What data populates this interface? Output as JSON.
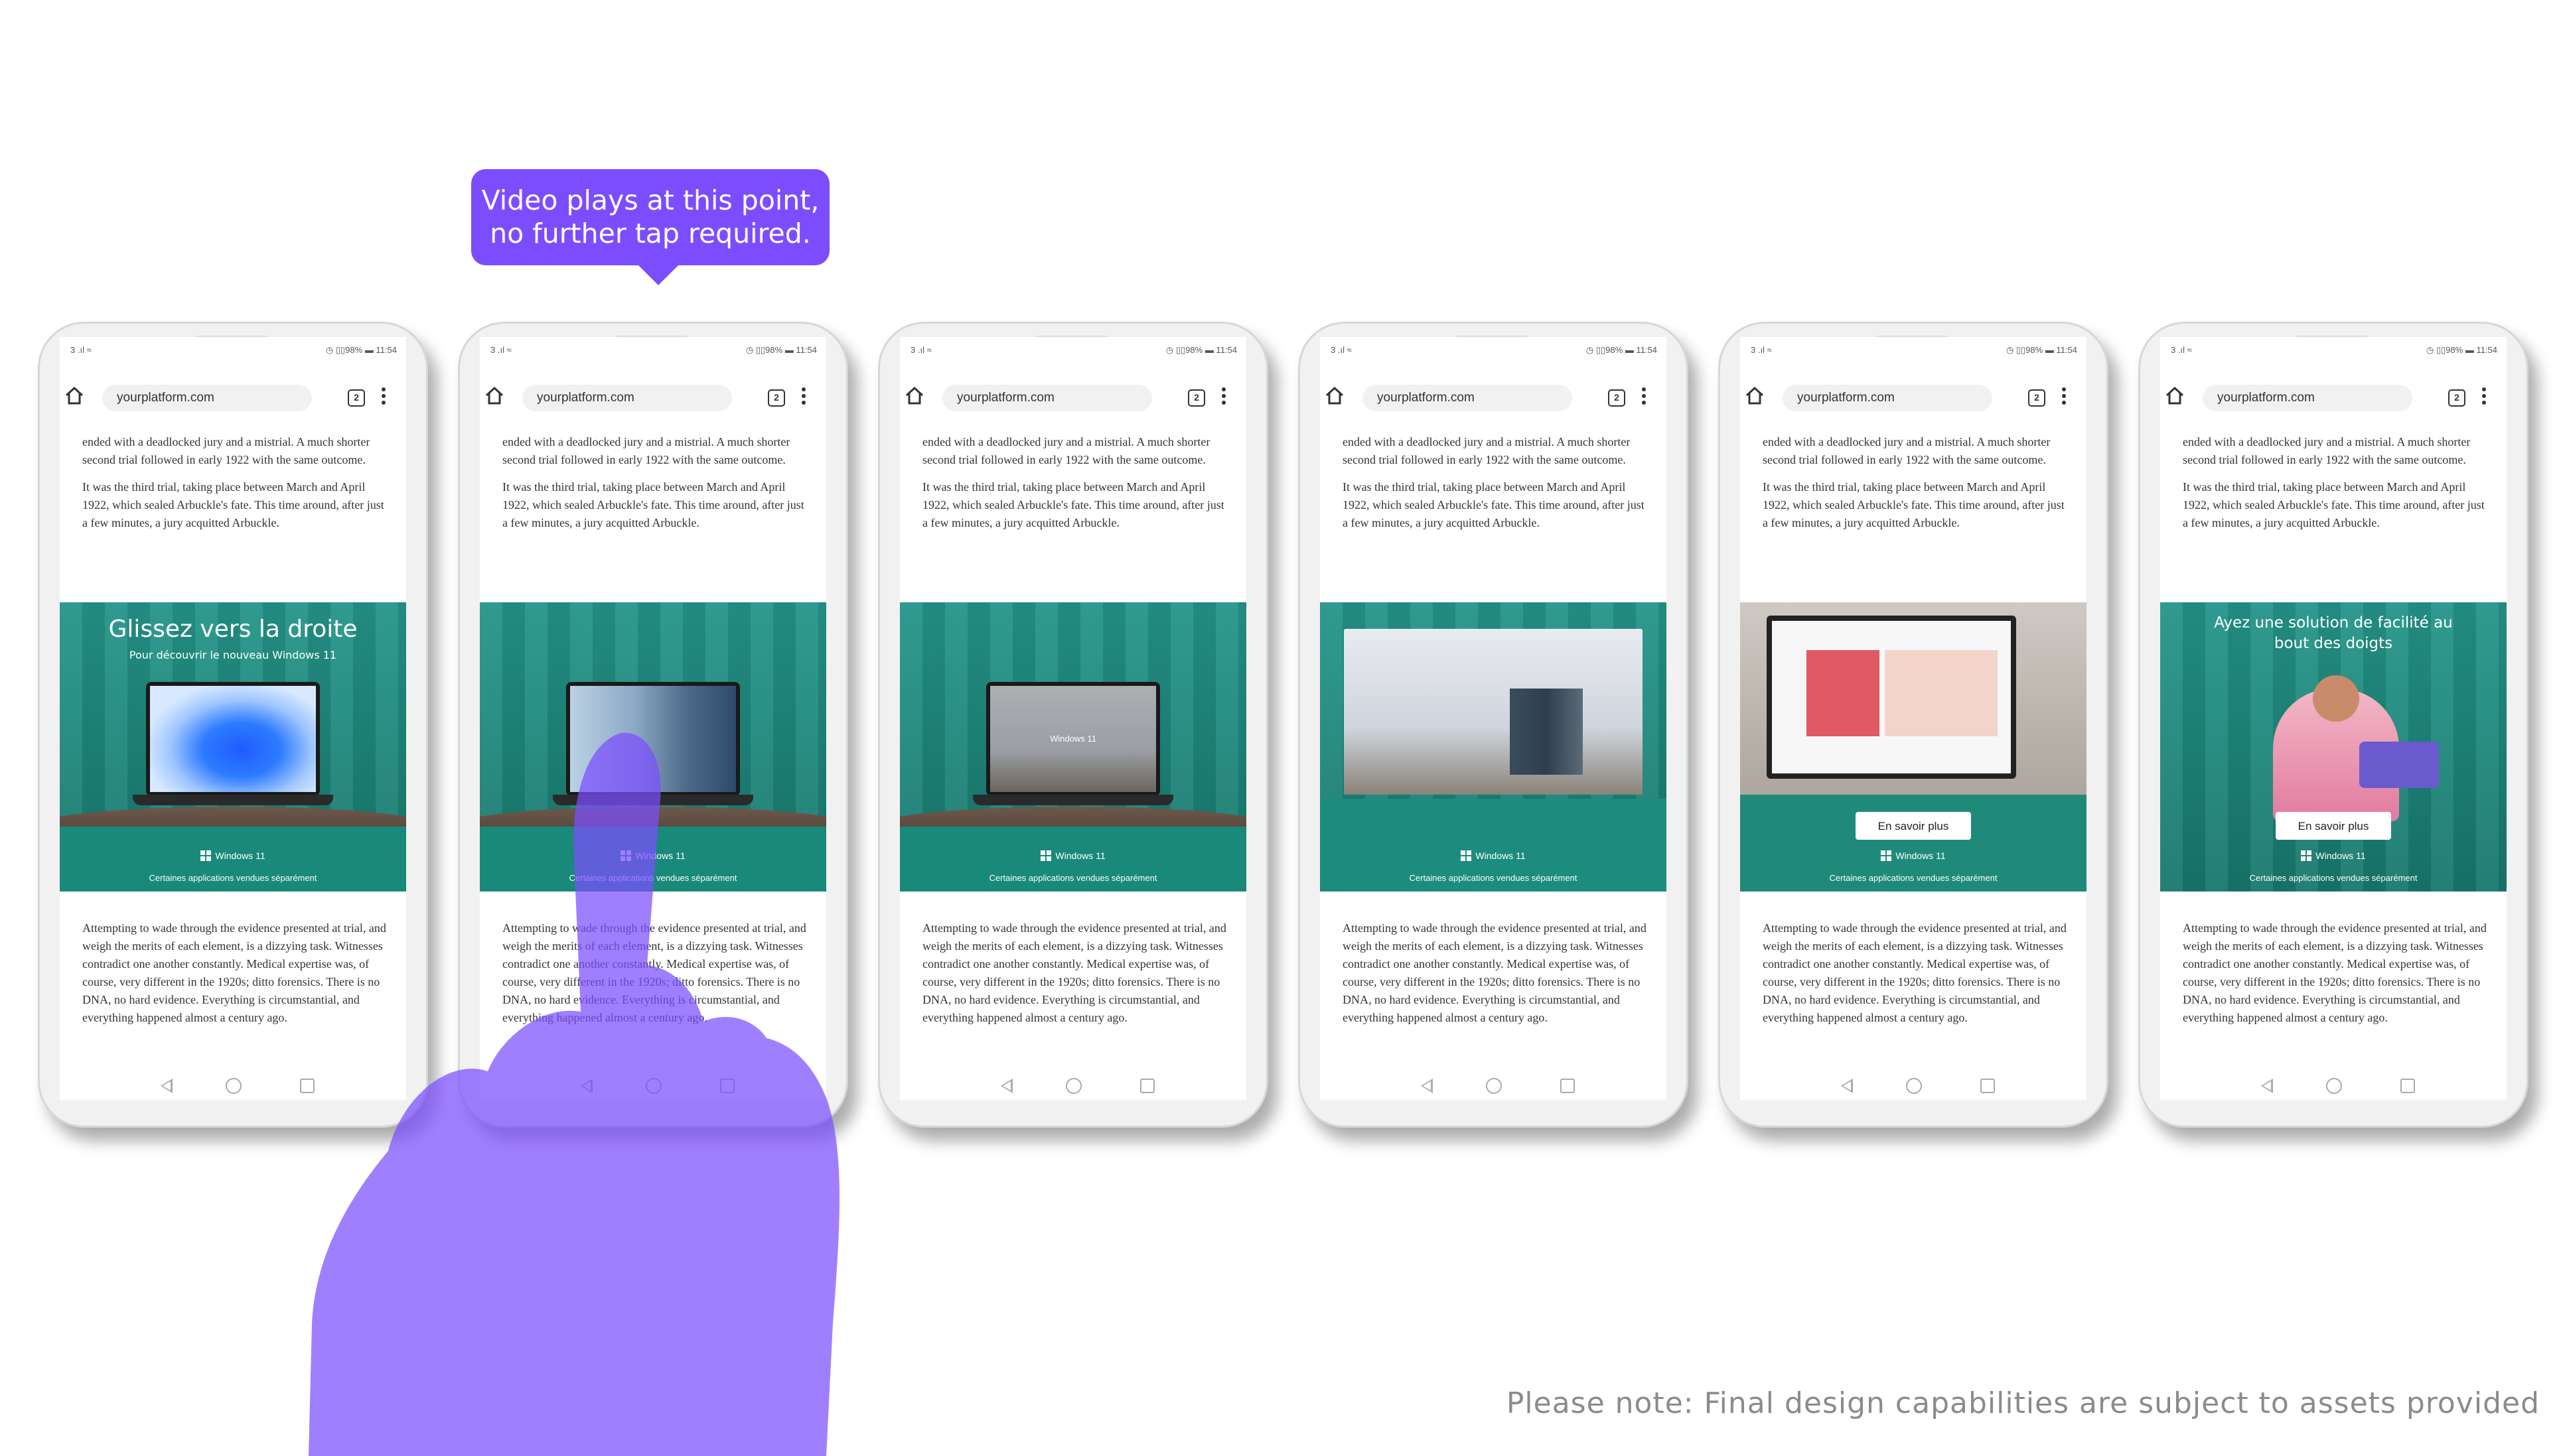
{
  "tooltip": {
    "line1": "Video plays at this point,",
    "line2": "no further tap required."
  },
  "phone_common": {
    "status_left": "3 .ıl ≈",
    "status_right": "◷ ▯▯98% ▬ 11:54",
    "url": "yourplatform.com",
    "tab_count": "2",
    "article_top_cut": "ended with a deadlocked jury and a mistrial. A much",
    "article_top_p1_rest": "shorter second trial followed in early 1922 with the same outcome.",
    "article_top_p2": "It was the third trial, taking place between March and April 1922, which sealed Arbuckle's fate. This time around, after just a few minutes, a jury acquitted Arbuckle.",
    "article_bottom": "Attempting to wade through the evidence presented at trial, and weigh the merits of each element, is a dizzying task. Witnesses contradict one another constantly. Medical expertise was, of course, very different in the 1920s; ditto forensics. There is no DNA, no hard evidence. Everything is circumstantial, and everything happened almost a century ago.",
    "windows_label": "Windows 11",
    "ad_disclaimer": "Certaines applications vendues séparément"
  },
  "ads": [
    {
      "headline": "Glissez vers la droite",
      "subheadline": "Pour découvrir le nouveau Windows 11"
    },
    {
      "headline": "",
      "subheadline": ""
    },
    {
      "headline": "",
      "subheadline": "",
      "laptop_label": "Windows 11"
    },
    {
      "headline": "",
      "subheadline": ""
    },
    {
      "headline": "",
      "subheadline": "",
      "cta": "En savoir plus"
    },
    {
      "headline": "Ayez une solution de facilité au bout des doigts",
      "subheadline": "",
      "cta": "En savoir plus"
    }
  ],
  "note": "Please note: Final design capabilities are subject to assets provided",
  "colors": {
    "accent_purple": "#7c4dff",
    "ad_teal": "#1f8a7a"
  }
}
